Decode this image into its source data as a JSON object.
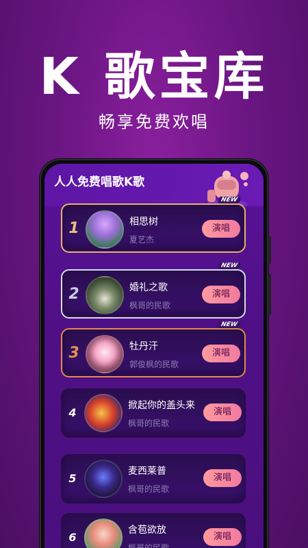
{
  "hero": {
    "title": "K 歌宝库",
    "subtitle": "畅享免费欢唱"
  },
  "screen": {
    "title": "人人免费唱歌K歌"
  },
  "list": [
    {
      "rank": "1",
      "song": "相思树",
      "artist": "夏艺杰",
      "button": "演唱",
      "badge": "NEW"
    },
    {
      "rank": "2",
      "song": "婚礼之歌",
      "artist": "枫哥的民歌",
      "button": "演唱",
      "badge": "NEW"
    },
    {
      "rank": "3",
      "song": "牡丹汗",
      "artist": "郭俊枫的民歌",
      "button": "演唱",
      "badge": "NEW"
    },
    {
      "rank": "4",
      "song": "掀起你的盖头来",
      "artist": "枫哥的民歌",
      "button": "演唱"
    },
    {
      "rank": "5",
      "song": "麦西莱普",
      "artist": "枫哥的民歌",
      "button": "演唱"
    },
    {
      "rank": "6",
      "song": "含苞欲放",
      "artist": "枫哥的民歌",
      "button": "演唱"
    }
  ],
  "colors": {
    "background": "#6a1682",
    "button_gradient_start": "#ff9a9e",
    "rank1": "#e9c27a",
    "rank2": "#c9cde0",
    "rank3": "#e59054"
  }
}
